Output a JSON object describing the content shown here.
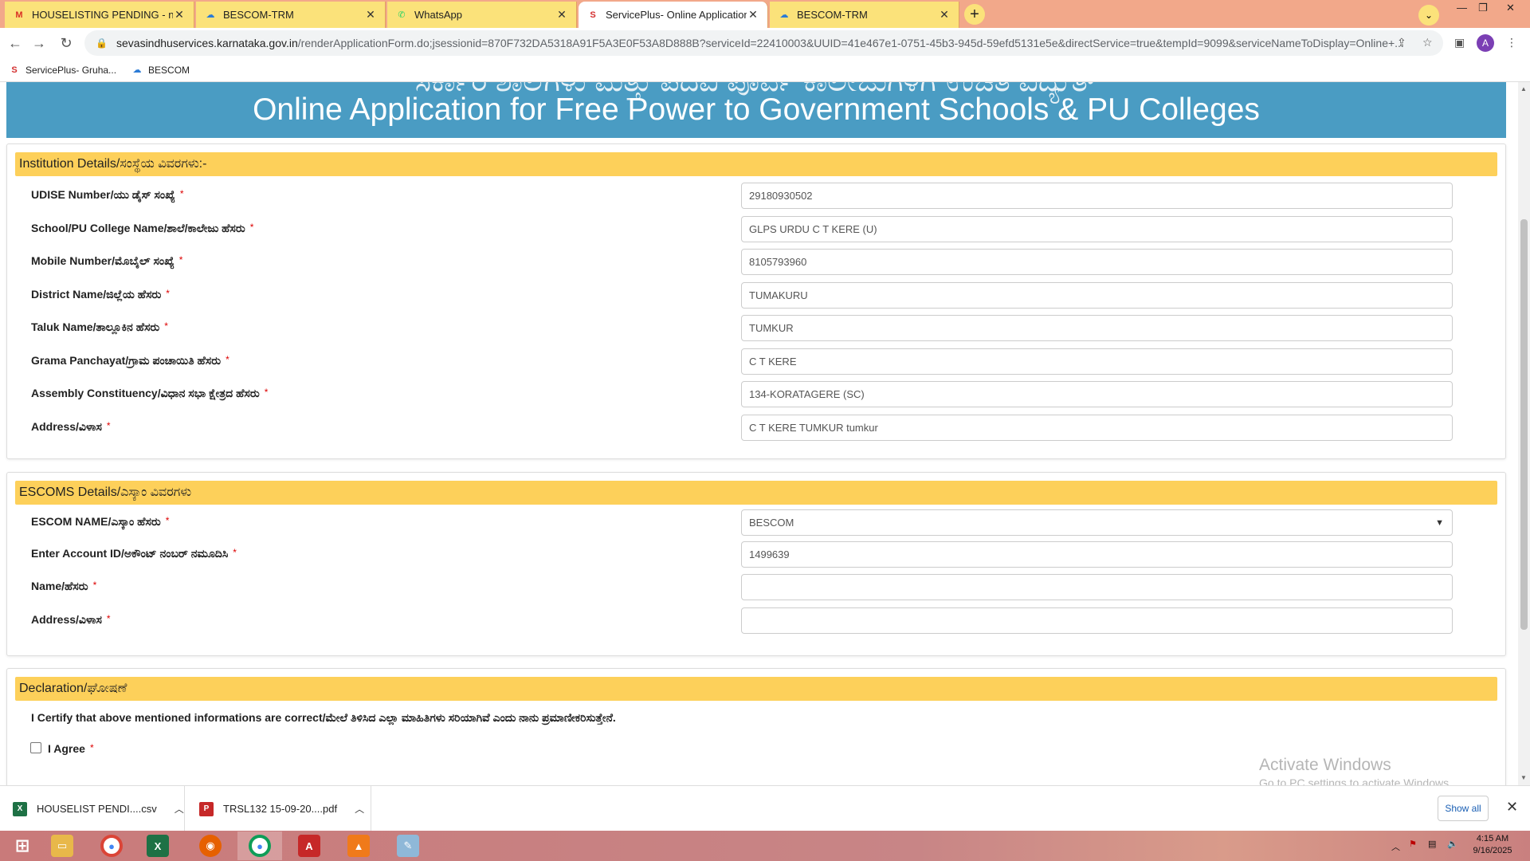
{
  "tabs": [
    {
      "title": "HOUSELISTING PENDING - nmkr",
      "icon": "gmail-icon",
      "favicon": "M",
      "color": "#d93025"
    },
    {
      "title": "BESCOM-TRM",
      "icon": "bescom-icon",
      "favicon": "☁",
      "color": "#2b7bd6"
    },
    {
      "title": "WhatsApp",
      "icon": "whatsapp-icon",
      "favicon": "✆",
      "color": "#25d366"
    },
    {
      "title": "ServicePlus- Online Application f",
      "icon": "serviceplus-icon",
      "favicon": "S",
      "color": "#d32f2f"
    },
    {
      "title": "BESCOM-TRM",
      "icon": "bescom-icon",
      "favicon": "☁",
      "color": "#2b7bd6"
    }
  ],
  "toolbar": {
    "url_host": "sevasindhuservices.karnataka.gov.in",
    "url_path": "/renderApplicationForm.do;jsessionid=870F732DA5318A91F5A3E0F53A8D888B?serviceId=22410003&UUID=41e467e1-0751-45b3-945d-59efd5131e5e&directService=true&tempId=9099&serviceNameToDisplay=Online+...",
    "profile_initial": "A"
  },
  "bookmarks": [
    {
      "label": "ServicePlus- Gruha...",
      "icon": "serviceplus-icon"
    },
    {
      "label": "BESCOM",
      "icon": "bescom-icon"
    }
  ],
  "banner": {
    "faded_title": "ಸರ್ಕಾರಿ ಶಾಲೆಗಳು ಮತ್ತು ಪದವಿ ಪೂರ್ವ ಕಾಲೇಜುಗಳಿಗೆ ಉಚಿತ ವಿದ್ಯುತ್",
    "title": "Online Application for Free Power to Government Schools & PU Colleges"
  },
  "institution": {
    "heading": "Institution Details/ಸಂಸ್ಥೆಯ ವಿವರಗಳು:-",
    "fields": [
      {
        "label": "UDISE Number/ಯು ಡೈಸ್ ಸಂಖ್ಯೆ",
        "value": "29180930502"
      },
      {
        "label": "School/PU College Name/ಶಾಲೆ/ಕಾಲೇಜು ಹೆಸರು",
        "value": "GLPS URDU C T KERE (U)"
      },
      {
        "label": "Mobile Number/ಮೊಬೈಲ್ ಸಂಖ್ಯೆ",
        "value": "8105793960"
      },
      {
        "label": "District Name/ಜಿಲ್ಲೆಯ ಹೆಸರು",
        "value": "TUMAKURU"
      },
      {
        "label": "Taluk Name/ತಾಲ್ಲೂಕಿನ ಹೆಸರು",
        "value": "TUMKUR"
      },
      {
        "label": "Grama Panchayat/ಗ್ರಾಮ ಪಂಚಾಯಿತಿ ಹೆಸರು",
        "value": "C T KERE"
      },
      {
        "label": "Assembly Constituency/ವಿಧಾನ ಸಭಾ ಕ್ಷೇತ್ರದ ಹೆಸರು",
        "value": "134-KORATAGERE (SC)"
      },
      {
        "label": "Address/ವಿಳಾಸ",
        "value": "C T KERE TUMKUR tumkur"
      }
    ]
  },
  "escoms": {
    "heading": "ESCOMS Details/ಎಸ್ಕಾಂ ವಿವರಗಳು",
    "fields": [
      {
        "label": "ESCOM NAME/ಎಸ್ಕಾಂ ಹೆಸರು",
        "value": "BESCOM",
        "type": "select"
      },
      {
        "label": "Enter Account ID/ಅಕೌಂಟ್ ನಂಬರ್ ನಮೂದಿಸಿ",
        "value": "1499639",
        "type": "text"
      },
      {
        "label": "Name/ಹೆಸರು",
        "value": "",
        "type": "text"
      },
      {
        "label": "Address/ವಿಳಾಸ",
        "value": "",
        "type": "text"
      }
    ]
  },
  "declaration": {
    "heading": "Declaration/ಘೋಷಣೆ",
    "text": "I Certify that above mentioned informations are correct/ಮೇಲೆ ತಿಳಿಸಿದ ಎಲ್ಲಾ ಮಾಹಿತಿಗಳು ಸರಿಯಾಗಿವೆ ಎಂದು ನಾನು ಪ್ರಮಾಣೀಕರಿಸುತ್ತೇನೆ.",
    "agree_label": "I Agree"
  },
  "required_mark": "*",
  "watermark": {
    "line1": "Activate Windows",
    "line2": "Go to PC settings to activate Windows."
  },
  "downloads": {
    "items": [
      {
        "name": "HOUSELIST PENDI....csv",
        "icon": "excel-file-icon"
      },
      {
        "name": "TRSL132 15-09-20....pdf",
        "icon": "pdf-file-icon"
      }
    ],
    "show_all": "Show all"
  },
  "taskbar": {
    "time": "4:15 AM",
    "date": "9/16/2025"
  }
}
